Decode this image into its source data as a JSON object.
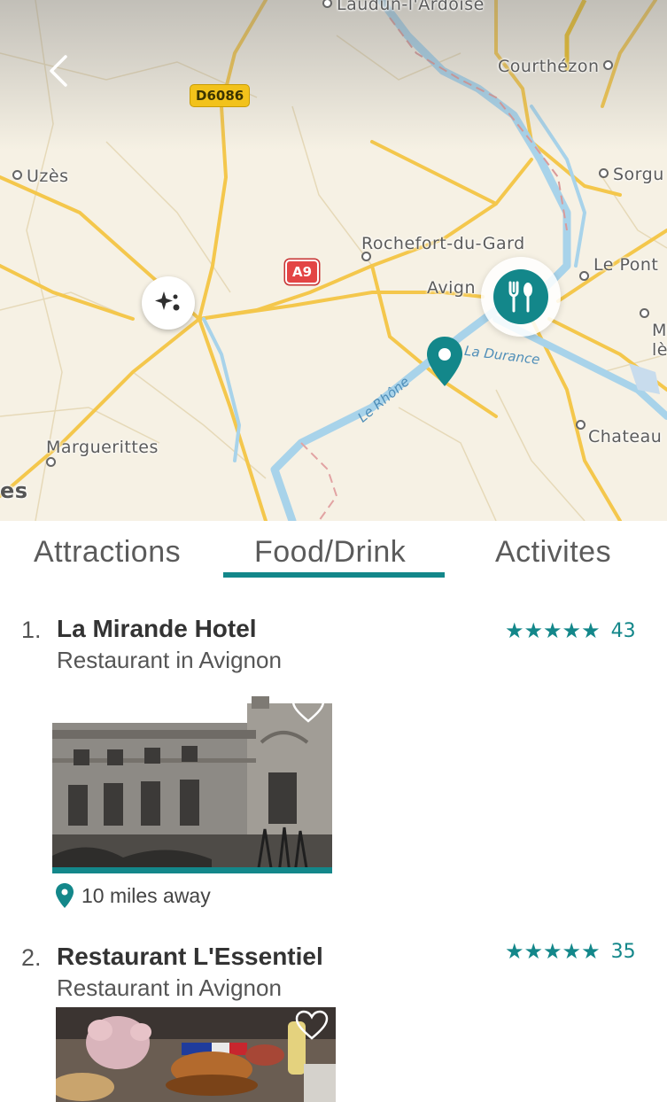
{
  "map": {
    "places": [
      {
        "name": "Laudun-l'Ardoise"
      },
      {
        "name": "Courthézon"
      },
      {
        "name": "Uzès"
      },
      {
        "name": "Sorgu"
      },
      {
        "name": "Rochefort-du-Gard"
      },
      {
        "name": "Le Pont"
      },
      {
        "name": "Avign"
      },
      {
        "name": "M"
      },
      {
        "name": "lè"
      },
      {
        "name": "Chateau"
      },
      {
        "name": "Marguerittes"
      },
      {
        "name": "es"
      }
    ],
    "roads": {
      "d6086": "D6086",
      "a9": "A9"
    },
    "rivers": {
      "durance": "La Durance",
      "rhone": "Le Rhône"
    },
    "icons": {
      "back": "chevron-left-icon",
      "sparkle": "sparkle-icon",
      "food": "fork-knife-icon",
      "pin": "location-pin-icon"
    }
  },
  "tabs": [
    {
      "label": "Attractions",
      "active": false
    },
    {
      "label": "Food/Drink",
      "active": true
    },
    {
      "label": "Activites",
      "active": false
    }
  ],
  "accent_color": "#13878a",
  "results": [
    {
      "rank": "1.",
      "name": "La Mirande Hotel",
      "category": "Restaurant in Avignon",
      "stars": "★★★★★",
      "rating": 5,
      "review_count": "43",
      "distance": "10 miles away"
    },
    {
      "rank": "2.",
      "name": "Restaurant L'Essentiel",
      "category": "Restaurant in Avignon",
      "stars": "★★★★★",
      "rating": 5,
      "review_count": "35"
    }
  ]
}
